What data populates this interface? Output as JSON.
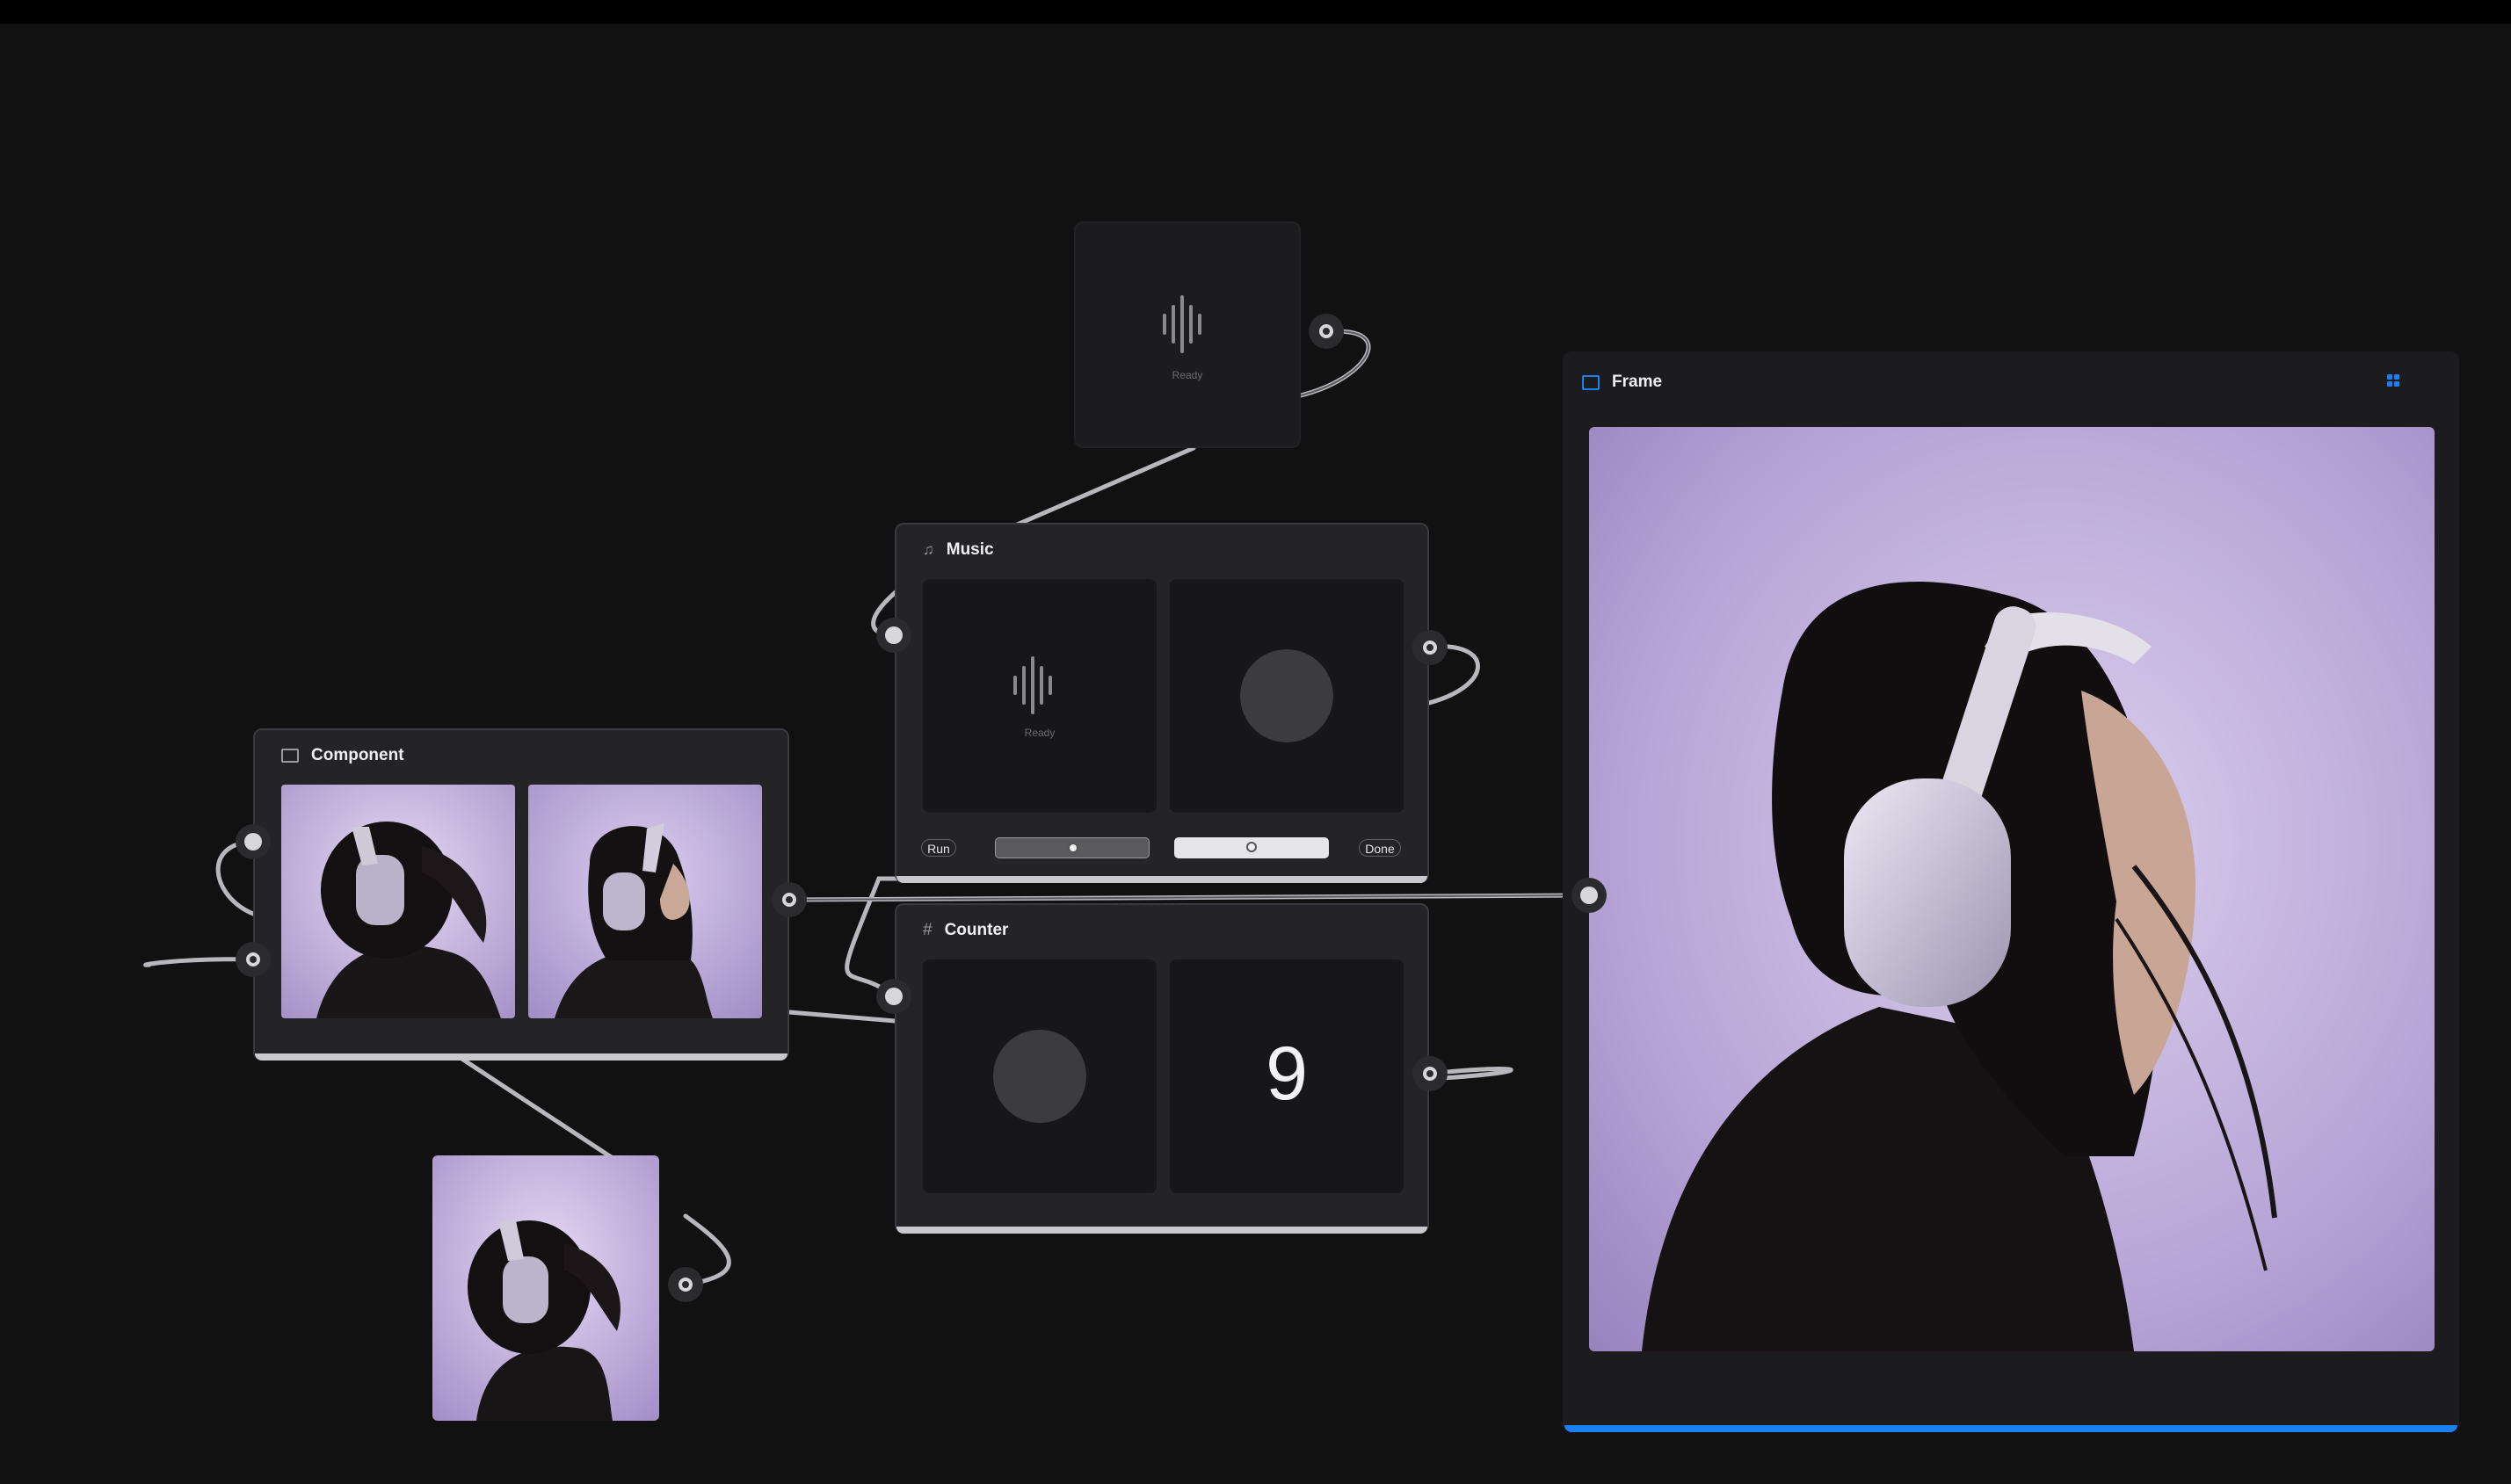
{
  "audio_node": {
    "status": "Ready"
  },
  "music_node": {
    "title": "Music",
    "icon": "music-note-icon",
    "tile_status": "Ready",
    "run_label": "Run",
    "done_label": "Done",
    "slider1_value": 0.5,
    "slider2_value": 0.5
  },
  "component_node": {
    "title": "Component",
    "icon": "component-icon"
  },
  "counter_node": {
    "title": "Counter",
    "icon": "hash-icon",
    "value": "9"
  },
  "frame_node": {
    "title": "Frame",
    "icon": "frame-icon",
    "action_icon": "grid-icon",
    "accent": "#1a7ff0"
  },
  "colors": {
    "canvas": "#111112",
    "node": "#242427",
    "tile": "#171719",
    "accent": "#1a7ff0"
  }
}
